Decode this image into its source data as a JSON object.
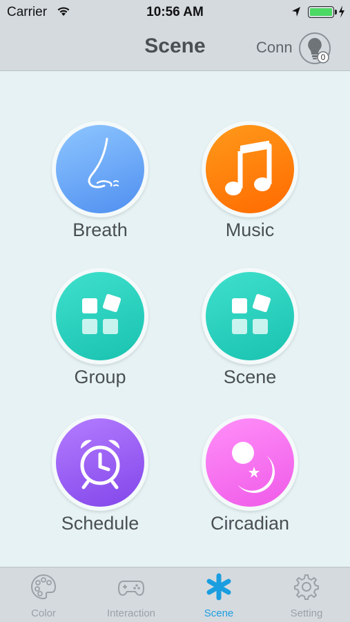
{
  "status_bar": {
    "carrier": "Carrier",
    "time": "10:56 AM",
    "battery_level": 1.0
  },
  "nav": {
    "title": "Scene",
    "conn": "Conn",
    "bulb_count": "0"
  },
  "tiles": [
    {
      "label": "Breath",
      "icon": "nose-icon",
      "color": "#5aa8f5"
    },
    {
      "label": "Music",
      "icon": "music-note-icon",
      "color": "#ff7a00"
    },
    {
      "label": "Group",
      "icon": "app-grid-icon",
      "color": "#25cdb9"
    },
    {
      "label": "Scene",
      "icon": "app-grid-icon",
      "color": "#25cdb9"
    },
    {
      "label": "Schedule",
      "icon": "alarm-clock-icon",
      "color": "#9a5cf2"
    },
    {
      "label": "Circadian",
      "icon": "moon-star-icon",
      "color": "#f46ef0"
    }
  ],
  "tabs": [
    {
      "label": "Color",
      "icon": "palette-icon"
    },
    {
      "label": "Interaction",
      "icon": "gamepad-icon"
    },
    {
      "label": "Scene",
      "icon": "asterisk-icon",
      "active": true
    },
    {
      "label": "Setting",
      "icon": "gear-icon"
    }
  ],
  "colors": {
    "accent": "#1a9ee0",
    "bar_bg": "#d5dadf",
    "content_bg": "#e6f2f4"
  }
}
